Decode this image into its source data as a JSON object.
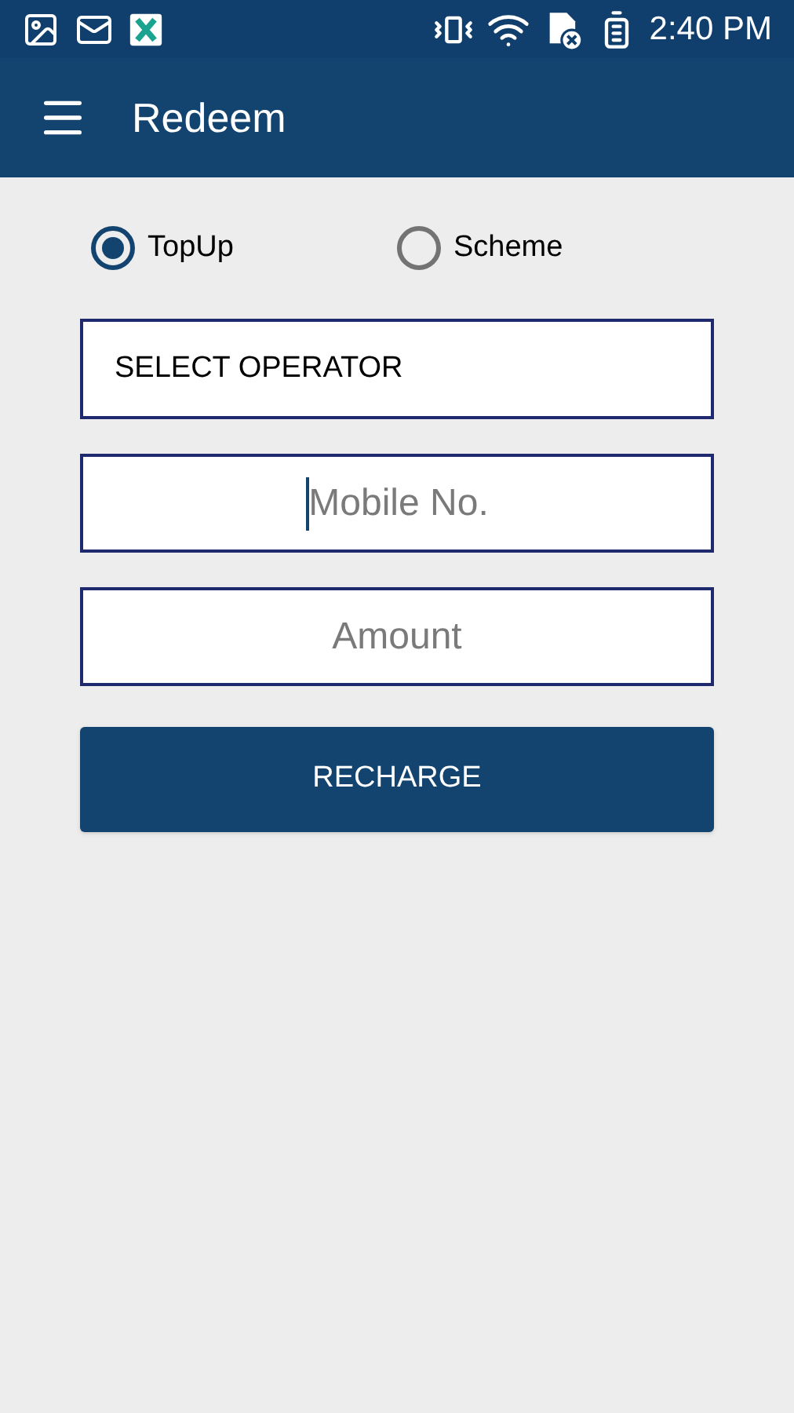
{
  "status_bar": {
    "time": "2:40 PM"
  },
  "app_bar": {
    "title": "Redeem"
  },
  "recharge_type": [
    {
      "label": "TopUp",
      "selected": true
    },
    {
      "label": "Scheme",
      "selected": false
    }
  ],
  "operator_select": {
    "value": "SELECT OPERATOR"
  },
  "fields": [
    {
      "placeholder": "Mobile No.",
      "focused": true
    },
    {
      "placeholder": "Amount",
      "focused": false
    }
  ],
  "button": {
    "label": "RECHARGE"
  }
}
